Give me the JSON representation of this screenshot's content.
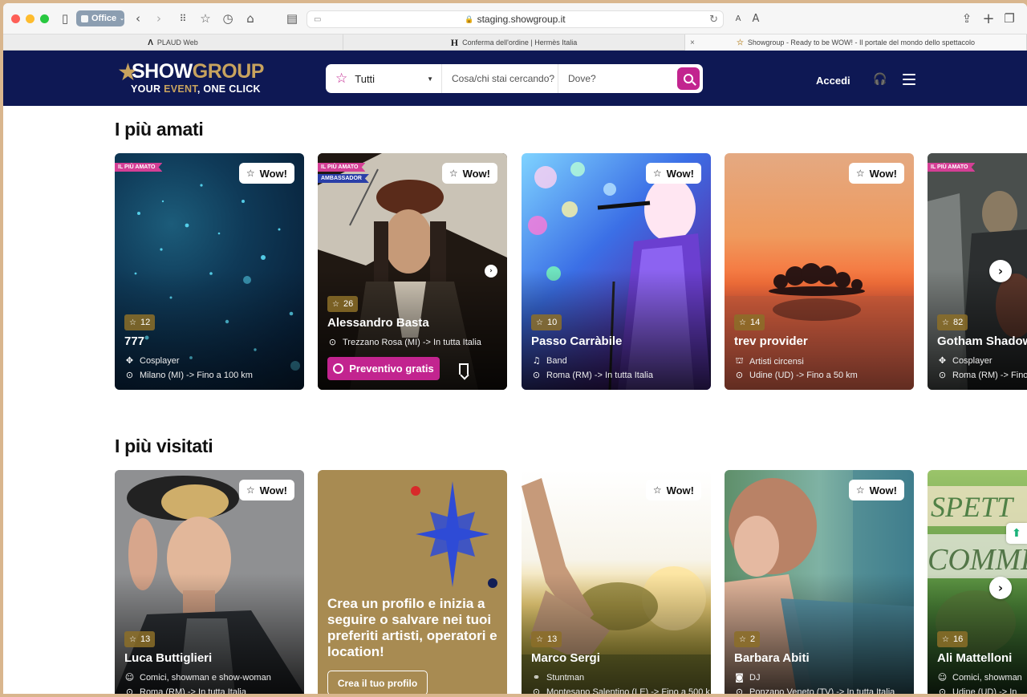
{
  "browser": {
    "profile": "Office",
    "url": "staging.showgroup.it",
    "tabs": [
      {
        "icon": "Λ",
        "title": "PLAUD Web"
      },
      {
        "icon": "H",
        "title": "Conferma dell'ordine | Hermès Italia"
      },
      {
        "icon": "☆",
        "title": "Showgroup - Ready to be WOW! - Il portale del mondo dello spettacolo"
      }
    ]
  },
  "header": {
    "logo": {
      "word_1": "SHOW",
      "word_2": "GROUP",
      "tag_1": "YOUR ",
      "tag_2": "EVENT",
      "tag_3": ", ONE CLICK"
    },
    "search": {
      "category": "Tutti",
      "what_placeholder": "Cosa/chi stai cercando?",
      "where_placeholder": "Dove?"
    },
    "login": "Accedi"
  },
  "sections": {
    "loved": {
      "title": "I più amati"
    },
    "visited": {
      "title": "I più visitati"
    }
  },
  "wow_label": "Wow!",
  "badges": {
    "loved": "IL PIÙ AMATO",
    "ambassador": "AMBASSADOR"
  },
  "loved_cards": [
    {
      "rating": "12",
      "name": "777",
      "category": "Cosplayer",
      "location": "Milano (MI) -> Fino a 100 km"
    },
    {
      "rating": "26",
      "name": "Alessandro Basta",
      "location": "Trezzano Rosa (MI) -> In tutta Italia",
      "cta": "Preventivo gratis"
    },
    {
      "rating": "10",
      "name": "Passo Carràbile",
      "category": "Band",
      "location": "Roma (RM) -> In tutta Italia"
    },
    {
      "rating": "14",
      "name": "trev provider",
      "category": "Artisti circensi",
      "location": "Udine (UD) -> Fino a 50 km"
    },
    {
      "rating": "82",
      "name": "Gotham Shadow",
      "category": "Cosplayer",
      "location": "Roma (RM) -> Fino"
    }
  ],
  "visited_cards": [
    {
      "rating": "13",
      "name": "Luca Buttiglieri",
      "category": "Comici, showman e show-woman",
      "location": "Roma (RM) -> In tutta Italia"
    },
    {
      "promo_text": "Crea un profilo e inizia a seguire o salvare nei tuoi preferiti artisti, operatori e location!",
      "promo_button": "Crea il tuo profilo"
    },
    {
      "rating": "13",
      "name": "Marco Sergi",
      "category": "Stuntman",
      "location": "Montesano Salentino (LE) -> Fino a 500 k"
    },
    {
      "rating": "2",
      "name": "Barbara Abiti",
      "category": "DJ",
      "location": "Ponzano Veneto (TV) -> In tutta Italia"
    },
    {
      "rating": "16",
      "name": "Ali Mattelloni",
      "category": "Comici, showman",
      "location": "Udine (UD) -> In"
    }
  ],
  "colors": {
    "brand_navy": "#0e1854",
    "brand_magenta": "#c2248f",
    "brand_gold": "#c8a35e"
  }
}
